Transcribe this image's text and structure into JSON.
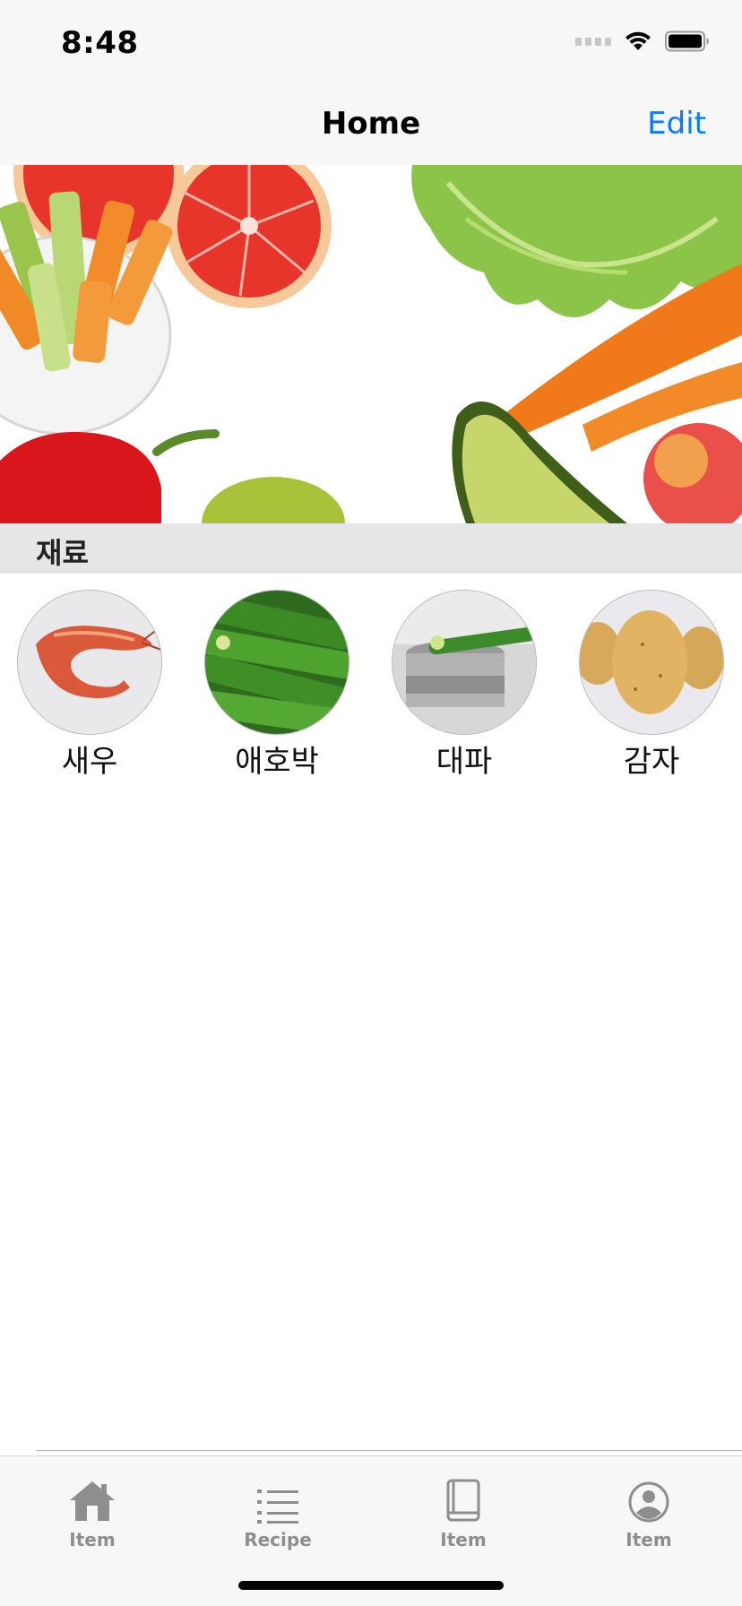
{
  "status_bar": {
    "time": "8:48"
  },
  "nav": {
    "title": "Home",
    "edit_label": "Edit"
  },
  "section": {
    "title": "재료"
  },
  "ingredients": [
    {
      "name": "새우",
      "icon": "shrimp-photo"
    },
    {
      "name": "애호박",
      "icon": "zucchini-photo"
    },
    {
      "name": "대파",
      "icon": "leek-photo"
    },
    {
      "name": "감자",
      "icon": "potato-photo"
    }
  ],
  "tabs": [
    {
      "label": "Item",
      "icon": "house-icon"
    },
    {
      "label": "Recipe",
      "icon": "list-icon"
    },
    {
      "label": "Item",
      "icon": "book-icon"
    },
    {
      "label": "Item",
      "icon": "person-circle-icon"
    }
  ],
  "colors": {
    "accent": "#0a7aff",
    "tab_inactive": "#8e8e8e",
    "bar_bg": "#f7f7f7",
    "section_bg": "#e6e6e6"
  }
}
